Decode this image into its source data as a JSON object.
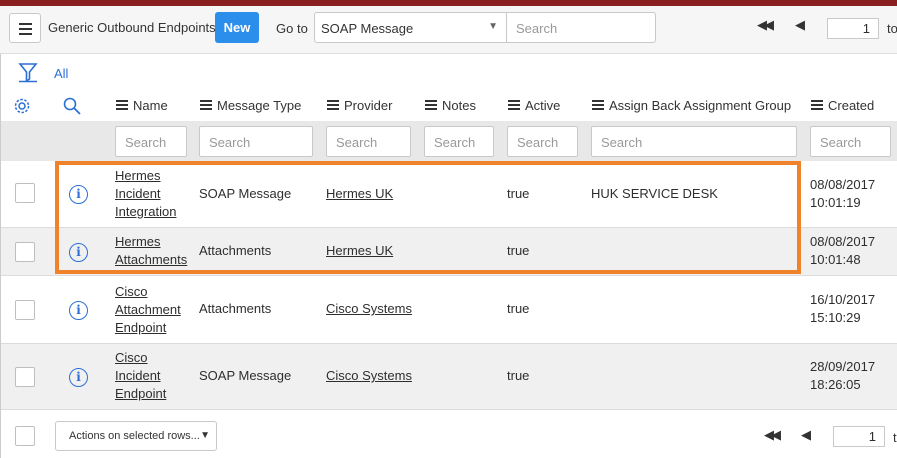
{
  "header": {
    "title": "Generic Outbound Endpoints",
    "new_label": "New",
    "goto_label": "Go to",
    "goto_field_value": "SOAP Message",
    "search_placeholder": "Search",
    "page_number": "1",
    "of_label": "to"
  },
  "filter": {
    "breadcrumb_all": "All"
  },
  "columns": [
    "Name",
    "Message Type",
    "Provider",
    "Notes",
    "Active",
    "Assign Back Assignment Group",
    "Created"
  ],
  "column_search_placeholder": "Search",
  "rows": [
    {
      "name": [
        "Hermes",
        "Incident",
        "Integration"
      ],
      "message_type": "SOAP Message",
      "provider": "Hermes UK",
      "notes": "",
      "active": "true",
      "assign_back_group": "HUK SERVICE DESK",
      "created": [
        "08/08/2017",
        "10:01:19"
      ]
    },
    {
      "name": [
        "Hermes",
        "Attachments"
      ],
      "message_type": "Attachments",
      "provider": "Hermes UK",
      "notes": "",
      "active": "true",
      "assign_back_group": "",
      "created": [
        "08/08/2017",
        "10:01:48"
      ]
    },
    {
      "name": [
        "Cisco",
        "Attachment",
        "Endpoint"
      ],
      "message_type": "Attachments",
      "provider": "Cisco Systems",
      "notes": "",
      "active": "true",
      "assign_back_group": "",
      "created": [
        "16/10/2017",
        "15:10:29"
      ]
    },
    {
      "name": [
        "Cisco",
        "Incident",
        "Endpoint"
      ],
      "message_type": "SOAP Message",
      "provider": "Cisco Systems",
      "notes": "",
      "active": "true",
      "assign_back_group": "",
      "created": [
        "28/09/2017",
        "18:26:05"
      ]
    }
  ],
  "footer": {
    "actions_label": "Actions on selected rows...",
    "page_number": "1",
    "of_label": "t"
  },
  "colors": {
    "primary_button": "#2b8eea",
    "highlight_border": "#f0832a",
    "link_blue": "#2b6fd6",
    "top_bar": "#8a1f1f"
  }
}
